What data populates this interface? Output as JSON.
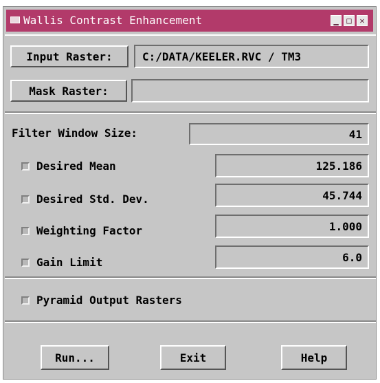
{
  "window": {
    "title": "Wallis Contrast Enhancement"
  },
  "rasters": {
    "input_button": "Input Raster:",
    "input_value": "C:/DATA/KEELER.RVC / TM3",
    "mask_button": "Mask Raster:",
    "mask_value": ""
  },
  "parameters": {
    "filter_window_label": "Filter Window Size:",
    "filter_window_value": "41",
    "rows": [
      {
        "label": "Desired Mean",
        "value": "125.186",
        "checked": false
      },
      {
        "label": "Desired Std. Dev.",
        "value": "45.744",
        "checked": false
      },
      {
        "label": "Weighting Factor",
        "value": "1.000",
        "checked": false
      },
      {
        "label": "Gain Limit",
        "value": "6.0",
        "checked": false
      }
    ]
  },
  "options": {
    "pyramid_label": "Pyramid Output Rasters",
    "pyramid_checked": false
  },
  "actions": {
    "run": "Run...",
    "exit": "Exit",
    "help": "Help"
  },
  "colors": {
    "titlebar": "#b23a6a",
    "panel": "#c6c6c6"
  }
}
